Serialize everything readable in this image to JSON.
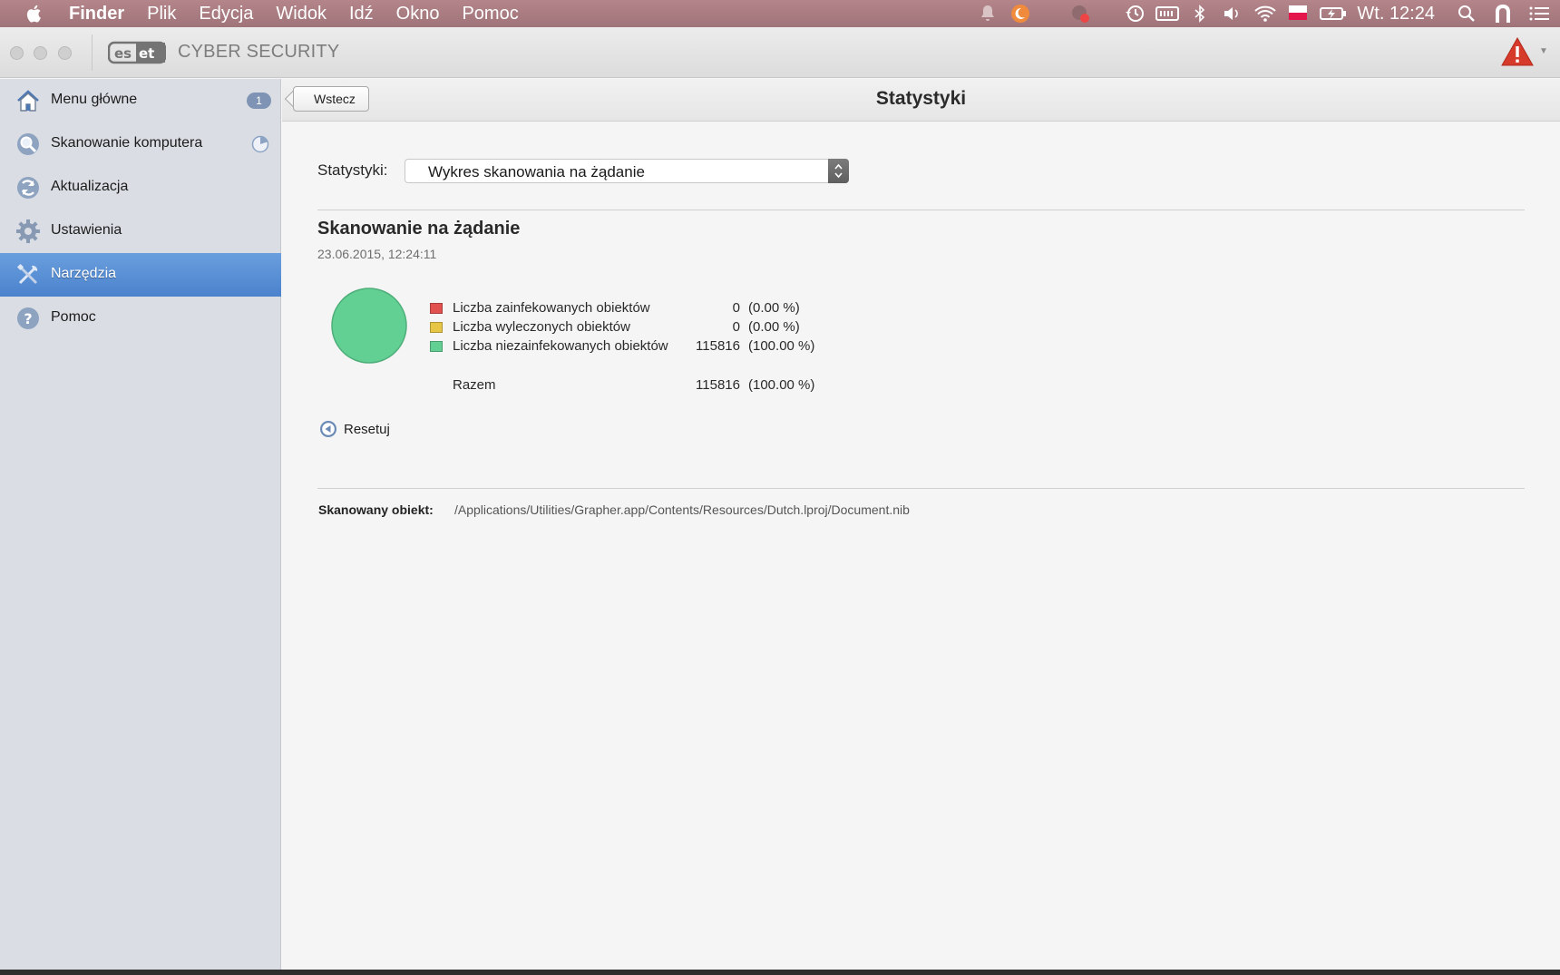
{
  "menubar": {
    "items": [
      "Finder",
      "Plik",
      "Edycja",
      "Widok",
      "Idź",
      "Okno",
      "Pomoc"
    ],
    "clock": "Wt. 12:24",
    "tray_icons": [
      "notification-bell-icon",
      "orange-app-icon",
      "app-badge-icon",
      "time-machine-icon",
      "keyboard-icon",
      "bluetooth-icon",
      "volume-icon",
      "wifi-icon",
      "flag-icon",
      "battery-icon",
      "spotlight-icon",
      "eset-tray-icon",
      "notification-center-icon"
    ]
  },
  "window": {
    "title": "CYBER SECURITY",
    "logo": "eset"
  },
  "sidebar": {
    "items": [
      {
        "label": "Menu główne",
        "icon": "home-icon",
        "badge": "1"
      },
      {
        "label": "Skanowanie komputera",
        "icon": "magnifier-icon"
      },
      {
        "label": "Aktualizacja",
        "icon": "refresh-icon"
      },
      {
        "label": "Ustawienia",
        "icon": "gear-icon"
      },
      {
        "label": "Narzędzia",
        "icon": "tools-icon",
        "active": true
      },
      {
        "label": "Pomoc",
        "icon": "help-icon"
      }
    ]
  },
  "content": {
    "back_label": "Wstecz",
    "title": "Statystyki",
    "stat_label": "Statystyki:",
    "stat_select_value": "Wykres skanowania na żądanie",
    "scan_title": "Skanowanie na żądanie",
    "scan_date": "23.06.2015, 12:24:11",
    "legend": [
      {
        "name": "Liczba zainfekowanych obiektów",
        "count": "0",
        "pct": "(0.00 %)",
        "color": "#e0514f"
      },
      {
        "name": "Liczba wyleczonych obiektów",
        "count": "0",
        "pct": "(0.00 %)",
        "color": "#e8c645"
      },
      {
        "name": "Liczba niezainfekowanych obiektów",
        "count": "115816",
        "pct": "(100.00 %)",
        "color": "#62cf93"
      }
    ],
    "total": {
      "name": "Razem",
      "count": "115816",
      "pct": "(100.00 %)"
    },
    "reset_label": "Resetuj",
    "scanned_label": "Skanowany obiekt:",
    "scanned_path": "/Applications/Utilities/Grapher.app/Contents/Resources/Dutch.lproj/Document.nib"
  },
  "chart_data": {
    "type": "pie",
    "categories": [
      "Liczba zainfekowanych obiektów",
      "Liczba wyleczonych obiektów",
      "Liczba niezainfekowanych obiektów"
    ],
    "values": [
      0,
      0,
      115816
    ],
    "colors": [
      "#e0514f",
      "#e8c645",
      "#62cf93"
    ]
  }
}
